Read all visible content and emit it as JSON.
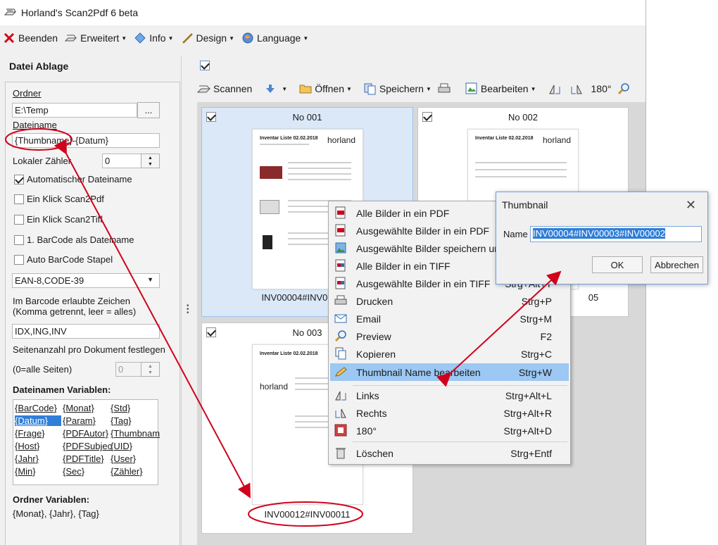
{
  "app": {
    "title": "Horland's Scan2Pdf 6 beta"
  },
  "menu": {
    "beenden": "Beenden",
    "erweitert": "Erweitert",
    "info": "Info",
    "design": "Design",
    "language": "Language"
  },
  "left_panel": {
    "title": "Datei Ablage",
    "ordner_label": "Ordner",
    "ordner_value": "E:\\Temp",
    "browse_button": "...",
    "dateiname_label": "Dateiname",
    "dateiname_value": "{Thumbname}-{Datum}",
    "lokaler_zaehler_label": "Lokaler Zähler",
    "lokaler_zaehler_value": "0",
    "checkboxes": [
      {
        "label": "Automatischer Dateiname",
        "checked": true
      },
      {
        "label": "Ein Klick Scan2Pdf",
        "checked": false
      },
      {
        "label": "Ein Klick Scan2Tiff",
        "checked": false
      },
      {
        "label": "1. BarCode als Dateiname",
        "checked": false
      },
      {
        "label": "Auto BarCode Stapel",
        "checked": false
      }
    ],
    "barcode_select": "EAN-8,CODE-39",
    "barcode_chars_label": "Im Barcode erlaubte Zeichen (Komma getrennt, leer = alles)",
    "barcode_chars_value": "IDX,ING,INV",
    "seitenanzahl_label": "Seitenanzahl pro Dokument festlegen",
    "alle_seiten_label": "(0=alle Seiten)",
    "seitenanzahl_value": "0",
    "dateinamen_variablen_title": "Dateinamen Variablen:",
    "variables": [
      [
        "{BarCode}",
        "{Monat}",
        "{Std}"
      ],
      [
        "{Datum}",
        "{Param}",
        "{Tag}"
      ],
      [
        "{Frage}",
        "{PDFAutor}",
        "{Thumbnam"
      ],
      [
        "{Host}",
        "{PDFSubjec",
        "{UID}"
      ],
      [
        "{Jahr}",
        "{PDFTitle}",
        "{User}"
      ],
      [
        "{Min}",
        "{Sec}",
        "{Zähler}"
      ]
    ],
    "selected_variable": "{Datum}",
    "ordner_variablen_title": "Ordner Variablen:",
    "ordner_variablen_value": "{Monat}, {Jahr}, {Tag}"
  },
  "toolbar": {
    "scannen": "Scannen",
    "oeffnen": "Öffnen",
    "speichern": "Speichern",
    "bearbeiten": "Bearbeiten",
    "rotate180": "180°"
  },
  "thumbnails": [
    {
      "title": "No 001",
      "caption": "INV00004#INV00003#",
      "checked": true,
      "selected": true
    },
    {
      "title": "No 002",
      "caption": "05",
      "checked": true,
      "selected": false
    },
    {
      "title": "No 003",
      "caption": "INV00012#INV00011",
      "checked": true,
      "selected": false
    }
  ],
  "doc_preview": {
    "heading": "Inventar Liste 02.02.2018",
    "logo": "horland"
  },
  "context_menu": [
    {
      "label": "Alle Bilder in ein PDF",
      "shortcut": "",
      "icon": "pdf-icon"
    },
    {
      "label": "Ausgewählte Bilder in ein PDF",
      "shortcut": "",
      "icon": "pdf-icon"
    },
    {
      "label": "Ausgewählte Bilder speichern unt",
      "shortcut": "",
      "icon": "image-icon"
    },
    {
      "label": "Alle Bilder in ein TIFF",
      "shortcut": "",
      "icon": "tiff-icon"
    },
    {
      "label": "Ausgewählte Bilder in ein TIFF",
      "shortcut": "Strg+Alt+T",
      "icon": "tiff-icon"
    },
    {
      "label": "Drucken",
      "shortcut": "Strg+P",
      "icon": "printer-icon"
    },
    {
      "label": "Email",
      "shortcut": "Strg+M",
      "icon": "email-icon"
    },
    {
      "label": "Preview",
      "shortcut": "F2",
      "icon": "magnifier-icon"
    },
    {
      "label": "Kopieren",
      "shortcut": "Strg+C",
      "icon": "copy-icon"
    },
    {
      "label": "Thumbnail Name bearbeiten",
      "shortcut": "Strg+W",
      "icon": "pencil-icon",
      "highlighted": true
    },
    {
      "label": "Links",
      "shortcut": "Strg+Alt+L",
      "icon": "rotate-left-icon"
    },
    {
      "label": "Rechts",
      "shortcut": "Strg+Alt+R",
      "icon": "rotate-right-icon"
    },
    {
      "label": "180°",
      "shortcut": "Strg+Alt+D",
      "icon": "rotate-180-icon"
    },
    {
      "label": "Löschen",
      "shortcut": "Strg+Entf",
      "icon": "trash-icon"
    }
  ],
  "dialog": {
    "title": "Thumbnail",
    "close": "✕",
    "name_label": "Name",
    "name_value": "INV00004#INV00003#INV00002",
    "ok": "OK",
    "cancel": "Abbrechen"
  },
  "colors": {
    "annotation_red": "#d0021b",
    "selection_blue": "#2f7ed8",
    "menu_highlight": "#9cc8f3"
  }
}
